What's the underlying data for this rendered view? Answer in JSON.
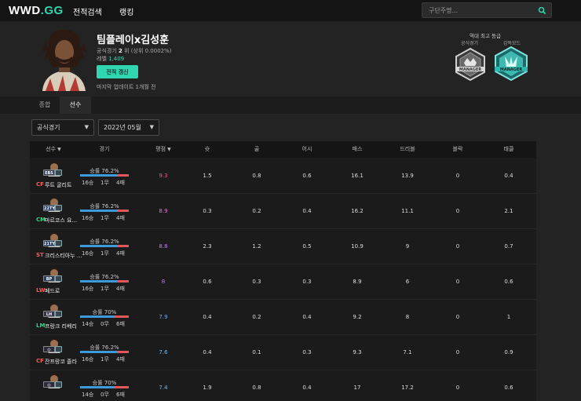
{
  "nav": {
    "logo_main": "WWD",
    "logo_dot": ".GG",
    "item1": "전적검색",
    "item2": "랭킹",
    "search_placeholder": "구단주명..."
  },
  "profile": {
    "team_name": "팀플레이x김성훈",
    "rank_prefix": "공식경기",
    "rank_num": "2",
    "rank_suffix": "위 (상위 0.0002%)",
    "level_label": "레벨",
    "level_value": "1,409",
    "refresh_label": "전적 갱신",
    "updated": "마지막 업데이트 1개월 전"
  },
  "best": {
    "title": "역대 최고 등급",
    "official_label": "공식경기",
    "manager_label": "감독모드"
  },
  "tabs": [
    "종합",
    "선수"
  ],
  "filters": {
    "mode": "공식경기",
    "month": "2022년 05월"
  },
  "headers": [
    "선수",
    "경기",
    "평점",
    "슛",
    "골",
    "어시",
    "패스",
    "드리블",
    "블락",
    "태클"
  ],
  "colors": {
    "accent": "#2fd6b0",
    "win_bar": "#3d9bdc",
    "loss_bar": "#e25757"
  },
  "players": [
    {
      "pos": "CF",
      "pos_color": "#ff5a5a",
      "name": "루트 굴리트",
      "season": "EBS",
      "season_color": "#2e3a52",
      "winrate": "승률 76.2%",
      "win_ratio": 0.762,
      "w": "16승",
      "d": "1무",
      "l": "4패",
      "rating": "9.3",
      "rating_color": "#f05a7e",
      "shot": "1.5",
      "goal": "0.8",
      "assist": "0.6",
      "pass": "16.1",
      "dribble": "13.9",
      "block": "0",
      "tackle": "0.4"
    },
    {
      "pos": "CM",
      "pos_color": "#2fd68a",
      "name": "마르코스 요...",
      "season": "22TY",
      "season_color": "#1e3a6a",
      "winrate": "승률 76.2%",
      "win_ratio": 0.762,
      "w": "16승",
      "d": "1무",
      "l": "4패",
      "rating": "8.9",
      "rating_color": "#e07ad0",
      "shot": "0.3",
      "goal": "0.2",
      "assist": "0.4",
      "pass": "16.2",
      "dribble": "11.1",
      "block": "0",
      "tackle": "2.1"
    },
    {
      "pos": "ST",
      "pos_color": "#ff5a5a",
      "name": "크리스티아누 ...",
      "season": "21TY",
      "season_color": "#1e3a6a",
      "winrate": "승률 76.2%",
      "win_ratio": 0.762,
      "w": "16승",
      "d": "1무",
      "l": "4패",
      "rating": "8.8",
      "rating_color": "#c07ae8",
      "shot": "2.3",
      "goal": "1.2",
      "assist": "0.5",
      "pass": "10.9",
      "dribble": "9",
      "block": "0",
      "tackle": "0.7"
    },
    {
      "pos": "LW",
      "pos_color": "#ff5a5a",
      "name": "페드로",
      "season": "BP",
      "season_color": "#2b3c5a",
      "winrate": "승률 76.2%",
      "win_ratio": 0.762,
      "w": "16승",
      "d": "1무",
      "l": "4패",
      "rating": "8",
      "rating_color": "#b07ae8",
      "shot": "0.6",
      "goal": "0.3",
      "assist": "0.3",
      "pass": "8.9",
      "dribble": "6",
      "block": "0",
      "tackle": "0.6"
    },
    {
      "pos": "LM",
      "pos_color": "#2fd68a",
      "name": "프랑크 리베리",
      "season": "LH",
      "season_color": "#33334a",
      "winrate": "승률 70%",
      "win_ratio": 0.7,
      "w": "14승",
      "d": "0무",
      "l": "6패",
      "rating": "7.9",
      "rating_color": "#7aa8e8",
      "shot": "0.4",
      "goal": "0.2",
      "assist": "0.4",
      "pass": "9.2",
      "dribble": "8",
      "block": "0",
      "tackle": "1"
    },
    {
      "pos": "CF",
      "pos_color": "#ff5a5a",
      "name": "잔프랑코 졸라",
      "season": "◎",
      "season_color": "#2a2a3a",
      "winrate": "승률 76.2%",
      "win_ratio": 0.762,
      "w": "16승",
      "d": "1무",
      "l": "4패",
      "rating": "7.6",
      "rating_color": "#7ab8e8",
      "shot": "0.4",
      "goal": "0.1",
      "assist": "0.3",
      "pass": "9.3",
      "dribble": "7.1",
      "block": "0",
      "tackle": "0.9"
    },
    {
      "pos": "",
      "pos_color": "#ff5a5a",
      "name": "",
      "season": "◎",
      "season_color": "#2a2a3a",
      "winrate": "승률 70%",
      "win_ratio": 0.7,
      "w": "14승",
      "d": "0무",
      "l": "6패",
      "rating": "7.4",
      "rating_color": "#7ab8e8",
      "shot": "1.9",
      "goal": "0.8",
      "assist": "0.4",
      "pass": "17",
      "dribble": "17.2",
      "block": "0",
      "tackle": "0.6"
    }
  ]
}
